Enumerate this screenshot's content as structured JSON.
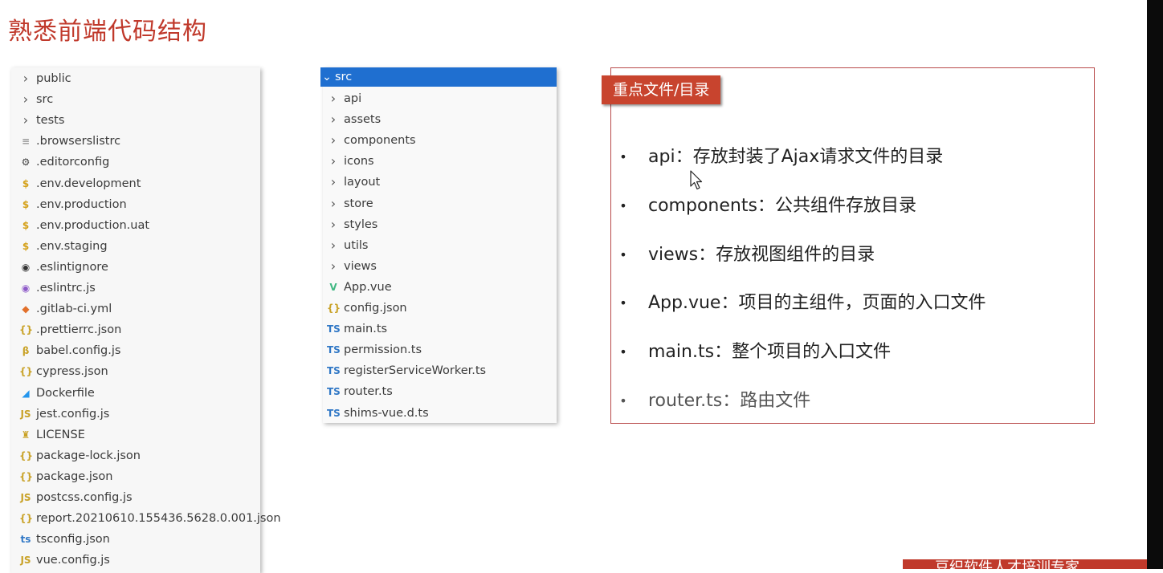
{
  "slide": {
    "title": "熟悉前端代码结构"
  },
  "root_tree": {
    "items": [
      {
        "label": "public",
        "icon": "chevron-right-icon",
        "icon_glyph": "›",
        "icon_color": "#555555"
      },
      {
        "label": "src",
        "icon": "chevron-right-icon",
        "icon_glyph": "›",
        "icon_color": "#555555"
      },
      {
        "label": "tests",
        "icon": "chevron-right-icon",
        "icon_glyph": "›",
        "icon_color": "#555555"
      },
      {
        "label": ".browserslistrc",
        "icon": "text-file-icon",
        "icon_glyph": "≡",
        "icon_color": "#9a9a9a"
      },
      {
        "label": ".editorconfig",
        "icon": "gear-icon",
        "icon_glyph": "⚙",
        "icon_color": "#444444"
      },
      {
        "label": ".env.development",
        "icon": "dollar-icon",
        "icon_glyph": "$",
        "icon_color": "#d4a017"
      },
      {
        "label": ".env.production",
        "icon": "dollar-icon",
        "icon_glyph": "$",
        "icon_color": "#d4a017"
      },
      {
        "label": ".env.production.uat",
        "icon": "dollar-icon",
        "icon_glyph": "$",
        "icon_color": "#d4a017"
      },
      {
        "label": ".env.staging",
        "icon": "dollar-icon",
        "icon_glyph": "$",
        "icon_color": "#d4a017"
      },
      {
        "label": ".eslintignore",
        "icon": "eslint-icon",
        "icon_glyph": "◉",
        "icon_color": "#333333"
      },
      {
        "label": ".eslintrc.js",
        "icon": "eslint-icon",
        "icon_glyph": "◉",
        "icon_color": "#8e5ac9"
      },
      {
        "label": ".gitlab-ci.yml",
        "icon": "gitlab-icon",
        "icon_glyph": "◆",
        "icon_color": "#e2702b"
      },
      {
        "label": ".prettierrc.json",
        "icon": "json-icon",
        "icon_glyph": "{}",
        "icon_color": "#c9a227"
      },
      {
        "label": "babel.config.js",
        "icon": "babel-icon",
        "icon_glyph": "β",
        "icon_color": "#c9a227"
      },
      {
        "label": "cypress.json",
        "icon": "json-icon",
        "icon_glyph": "{}",
        "icon_color": "#c9a227"
      },
      {
        "label": "Dockerfile",
        "icon": "docker-icon",
        "icon_glyph": "◢",
        "icon_color": "#2496ed"
      },
      {
        "label": "jest.config.js",
        "icon": "js-icon",
        "icon_glyph": "JS",
        "icon_color": "#c9a227"
      },
      {
        "label": "LICENSE",
        "icon": "license-icon",
        "icon_glyph": "♜",
        "icon_color": "#c9a227"
      },
      {
        "label": "package-lock.json",
        "icon": "json-icon",
        "icon_glyph": "{}",
        "icon_color": "#c9a227"
      },
      {
        "label": "package.json",
        "icon": "json-icon",
        "icon_glyph": "{}",
        "icon_color": "#c9a227"
      },
      {
        "label": "postcss.config.js",
        "icon": "js-icon",
        "icon_glyph": "JS",
        "icon_color": "#c9a227"
      },
      {
        "label": "report.20210610.155436.5628.0.001.json",
        "icon": "json-icon",
        "icon_glyph": "{}",
        "icon_color": "#c9a227"
      },
      {
        "label": "tsconfig.json",
        "icon": "tsconfig-icon",
        "icon_glyph": "ts",
        "icon_color": "#3178c6"
      },
      {
        "label": "vue.config.js",
        "icon": "js-icon",
        "icon_glyph": "JS",
        "icon_color": "#c9a227"
      }
    ]
  },
  "src_tree": {
    "header": {
      "label": "src",
      "icon": "chevron-down-icon",
      "icon_glyph": "⌄"
    },
    "header_color": "#1f6fd0",
    "items": [
      {
        "label": "api",
        "icon": "chevron-right-icon",
        "icon_glyph": "›",
        "icon_color": "#555555"
      },
      {
        "label": "assets",
        "icon": "chevron-right-icon",
        "icon_glyph": "›",
        "icon_color": "#555555"
      },
      {
        "label": "components",
        "icon": "chevron-right-icon",
        "icon_glyph": "›",
        "icon_color": "#555555"
      },
      {
        "label": "icons",
        "icon": "chevron-right-icon",
        "icon_glyph": "›",
        "icon_color": "#555555"
      },
      {
        "label": "layout",
        "icon": "chevron-right-icon",
        "icon_glyph": "›",
        "icon_color": "#555555"
      },
      {
        "label": "store",
        "icon": "chevron-right-icon",
        "icon_glyph": "›",
        "icon_color": "#555555"
      },
      {
        "label": "styles",
        "icon": "chevron-right-icon",
        "icon_glyph": "›",
        "icon_color": "#555555"
      },
      {
        "label": "utils",
        "icon": "chevron-right-icon",
        "icon_glyph": "›",
        "icon_color": "#555555"
      },
      {
        "label": "views",
        "icon": "chevron-right-icon",
        "icon_glyph": "›",
        "icon_color": "#555555"
      },
      {
        "label": "App.vue",
        "icon": "vue-icon",
        "icon_glyph": "V",
        "icon_color": "#41b883"
      },
      {
        "label": "config.json",
        "icon": "json-icon",
        "icon_glyph": "{}",
        "icon_color": "#c9a227"
      },
      {
        "label": "main.ts",
        "icon": "ts-icon",
        "icon_glyph": "TS",
        "icon_color": "#3178c6"
      },
      {
        "label": "permission.ts",
        "icon": "ts-icon",
        "icon_glyph": "TS",
        "icon_color": "#3178c6"
      },
      {
        "label": "registerServiceWorker.ts",
        "icon": "ts-icon",
        "icon_glyph": "TS",
        "icon_color": "#3178c6"
      },
      {
        "label": "router.ts",
        "icon": "ts-icon",
        "icon_glyph": "TS",
        "icon_color": "#3178c6"
      },
      {
        "label": "shims-vue.d.ts",
        "icon": "ts-icon",
        "icon_glyph": "TS",
        "icon_color": "#3178c6"
      }
    ]
  },
  "key_points": {
    "header": "重点文件/目录",
    "accent_color": "#c8442e",
    "bullet_glyph": "•",
    "bullets": [
      {
        "name": "api",
        "desc": "存放封装了Ajax请求文件的目录"
      },
      {
        "name": "components",
        "desc": "公共组件存放目录"
      },
      {
        "name": "views",
        "desc": "存放视图组件的目录"
      },
      {
        "name": "App.vue",
        "desc": "项目的主组件，页面的入口文件"
      },
      {
        "name": "main.ts",
        "desc": "整个项目的入口文件"
      },
      {
        "name": "router.ts",
        "desc": "路由文件"
      }
    ]
  },
  "footer_ribbon": {
    "text": "豆织软件人才培训专家"
  }
}
